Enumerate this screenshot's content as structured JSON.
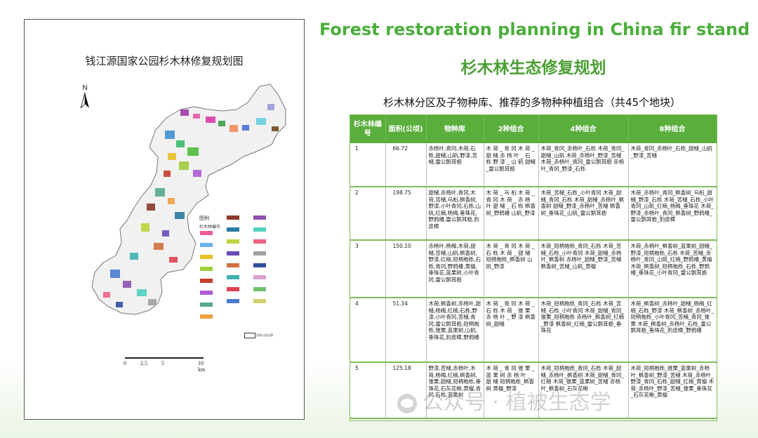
{
  "map": {
    "title": "钱江源国家公园杉木林修复规划图",
    "north_label": "N",
    "legend_title": "图例",
    "legend_subtitle": "杉木林编号",
    "scale_ticks": [
      "0",
      "2.5",
      "5",
      "10 km"
    ],
    "legend_extra_label": "国家公园边界"
  },
  "header": {
    "en_title": "Forest restoration planning in China fir stand",
    "cn_title": "杉木林生态修复规划",
    "table_caption": "杉木林分区及子物种库、推荐的多物种种植组合（共45个地块）"
  },
  "table": {
    "columns": [
      "杉木林编号",
      "面积(公顷)",
      "物种库",
      "2种组合",
      "4种组合",
      "8种组合"
    ],
    "rows": [
      {
        "id": "1",
        "area": "66.72",
        "pool": "赤杨叶,青冈,木荷,石栎,甜槠,山矾,野漆,苦槠,雷公鹅耳枥",
        "two": "木 荷 _ 青 冈 木 荷 _ 甜 槠 赤 杨 叶 _ 石 栎 野 漆 _ 山 矾 甜槠_雷公鹅耳枥",
        "four": "木荷_青冈_赤杨叶_石栎 木荷_青冈_甜槠_山矾 木荷_赤杨叶_野漆_苦槠 木荷_赤杨叶_青冈_雷公鹅耳枥 赤杨叶_青冈_野漆_石栎",
        "eight": "木荷_青冈_赤杨叶_石栎_甜槠_山矾_野漆_苦槠"
      },
      {
        "id": "2",
        "area": "198.75",
        "pool": "甜槠,赤杨叶,青冈,木荷,苦槠,乌桕,枫香树,野漆,小叶青冈,石栎,山矾,红楠,杨梅,垂珠花,野鸦椿,雷公鹅耳枥,豹皮樟",
        "two": "木 荷 _ 乌 桕 木 荷 _ 青 冈 木 荷 _ 赤 杨 叶 甜 槠 _ 石 栎 枫香树_野鸦椿 山矾_野漆",
        "four": "木荷_苦槠_石栎_小叶青冈 木荷_甜槠_青冈_石栎 木荷_甜槠_赤杨叶_枫香树 甜槠_野漆_赤杨叶_苦槠 枫香树_垂珠花_山矾_雷公鹅耳枥",
        "eight": "木荷_赤杨叶_青冈_枫香树_乌桕_甜槠_野漆_石栎 木荷_苦槠_石栎_小叶青冈_山矾_红楠_杨梅_垂珠花 木荷_野漆_赤杨叶_青冈_枫香树_野鸦椿_雷公鹅耳枥_豹皮樟"
      },
      {
        "id": "3",
        "area": "150.10",
        "pool": "赤杨叶,杨梅,木荷,甜槠,苦槠,山矾,枫香树,野漆,红楠,短柄枹栎,石栎,青冈,野鸦椿,黄檀,垂珠花,蓝果树,小叶青冈,雷公鹅耳枥",
        "two": "木 荷 _ 青 冈 木 荷 _ 石 栎 木 荷 _ 甜 槠 短柄枹栎_枫香树 山矾_野漆",
        "four": "木荷_短柄枹栎_青冈_石栎 木荷_苦槠_石栎_小叶青冈 木荷_甜槠_赤杨叶_枫香树 赤杨叶_甜槠_野漆_苦槠 枫香树_苦槠_山矾_黄檀",
        "eight": "木荷_赤杨叶_枫香树_蓝果树_甜槠_野漆_短柄枹栎_石栎 木荷_苦槠_赤杨叶_青冈_山矾_红楠_野鸦椿_黄檀 木荷_枫香树_短柄枹栎_石栎_野鸦椿_垂珠花_小叶青冈_雷公鹅耳枥"
      },
      {
        "id": "4",
        "area": "51.34",
        "pool": "木荷,枫香树,赤杨叶,甜槠,杨梅,红楠,石栎,野漆,小叶青冈,苦槠,青冈,雷公鹅耳枥,短柄枹栎,锥栗,蓝果树,山矾,垂珠花,豹皮樟,野鸦椿",
        "two": "木 荷 _ 青 冈 木 荷 _ 石 栎 木 荷 _ 锥 栗 赤 杨 叶 _ 野 漆 枫香树_甜槠",
        "four": "木荷_短柄枹栎_青冈_石栎 木荷_苦槠_石栎_小叶青冈 木荷_甜槠_青冈_锥栗_短柄枹栎 赤杨叶_枫香树_红楠_野漆 枫香树_红楠_雷公鹅耳枥_垂珠花",
        "eight": "木荷_枫香树_赤杨叶_甜槠_杨梅_红楠_石栎_野漆 木荷_枫香树_赤杨叶_短柄枹栎_小叶青冈_苦槠_青冈_锥栗 木荷_枫香树_赤杨叶_石栎_雷公鹅耳枥_垂珠花_豹皮樟_野鸦椿"
      },
      {
        "id": "5",
        "area": "125.18",
        "pool": "野漆,苦槠,赤杨叶,木荷,杨梅,红楠,枫香树,锥栗,甜槠,短柄枹栎,垂珠花,石灰花楸,黄檀,青冈,石栎,蓝果树",
        "two": "木 荷 _ 青 冈 锥 栗 _ 蓝 果 树 赤 杨 叶 _ 甜 槠 短柄枹栎_枫香树 黄檀_野漆",
        "four": "木荷_短柄枹栎_青冈_石栎 木荷_甜槠_赤杨叶_枫香树 木荷_甜槠_青冈_红楠 木荷_锥栗_蓝果树_苦槠 赤杨叶_枫香树_石灰花楸",
        "eight": "木荷_短柄枹栎_锥栗_蓝果树_赤杨叶_枫香树_野漆_苦槠 木荷_赤杨叶_野漆_青冈_石栎_甜槠_红楠_黄檀 木荷_赤杨叶_野漆_苦槠_锥栗_垂珠花_石灰花楸_黄檀"
      }
    ]
  },
  "watermark": "公众号 · 植被生态学",
  "colors": {
    "title_green": "#4cae3c",
    "header_green": "#5aae3c",
    "border_green": "#7bbf5a"
  }
}
